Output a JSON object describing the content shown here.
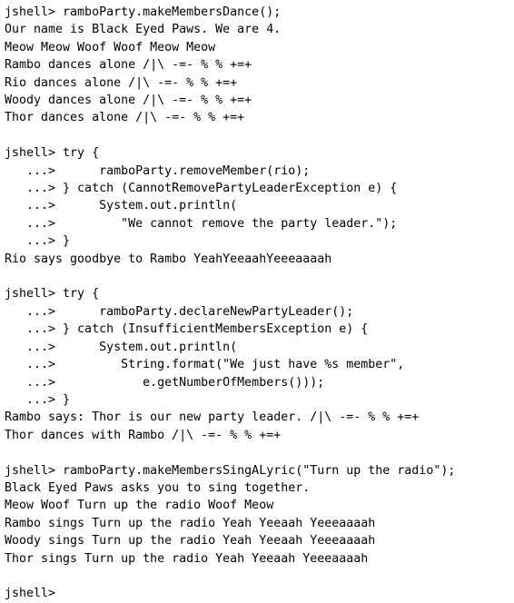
{
  "window": {
    "title": "jshell",
    "background_color": "#ffffff",
    "foreground_color": "#000000"
  },
  "terminal": {
    "prompt": "jshell>",
    "continuation_prompt": "   ...>",
    "cursor_line_index": 34,
    "lines": [
      "jshell> ramboParty.makeMembersDance();",
      "Our name is Black Eyed Paws. We are 4.",
      "Meow Meow Woof Woof Meow Meow",
      "Rambo dances alone /|\\ -=- % % +=+",
      "Rio dances alone /|\\ -=- % % +=+",
      "Woody dances alone /|\\ -=- % % +=+",
      "Thor dances alone /|\\ -=- % % +=+",
      "",
      "jshell> try {",
      "   ...>      ramboParty.removeMember(rio);",
      "   ...> } catch (CannotRemovePartyLeaderException e) {",
      "   ...>      System.out.println(",
      "   ...>         \"We cannot remove the party leader.\");",
      "   ...> }",
      "Rio says goodbye to Rambo YeahYeeaahYeeeaaaah",
      "",
      "jshell> try {",
      "   ...>      ramboParty.declareNewPartyLeader();",
      "   ...> } catch (InsufficientMembersException e) {",
      "   ...>      System.out.println(",
      "   ...>         String.format(\"We just have %s member\",",
      "   ...>            e.getNumberOfMembers()));",
      "   ...> }",
      "Rambo says: Thor is our new party leader. /|\\ -=- % % +=+",
      "Thor dances with Rambo /|\\ -=- % % +=+",
      "",
      "jshell> ramboParty.makeMembersSingALyric(\"Turn up the radio\");",
      "Black Eyed Paws asks you to sing together.",
      "Meow Woof Turn up the radio Woof Meow",
      "Rambo sings Turn up the radio Yeah Yeeaah Yeeeaaaah",
      "Woody sings Turn up the radio Yeah Yeeaah Yeeeaaaah",
      "Thor sings Turn up the radio Yeah Yeeaah Yeeeaaaah",
      "",
      "jshell>"
    ]
  }
}
